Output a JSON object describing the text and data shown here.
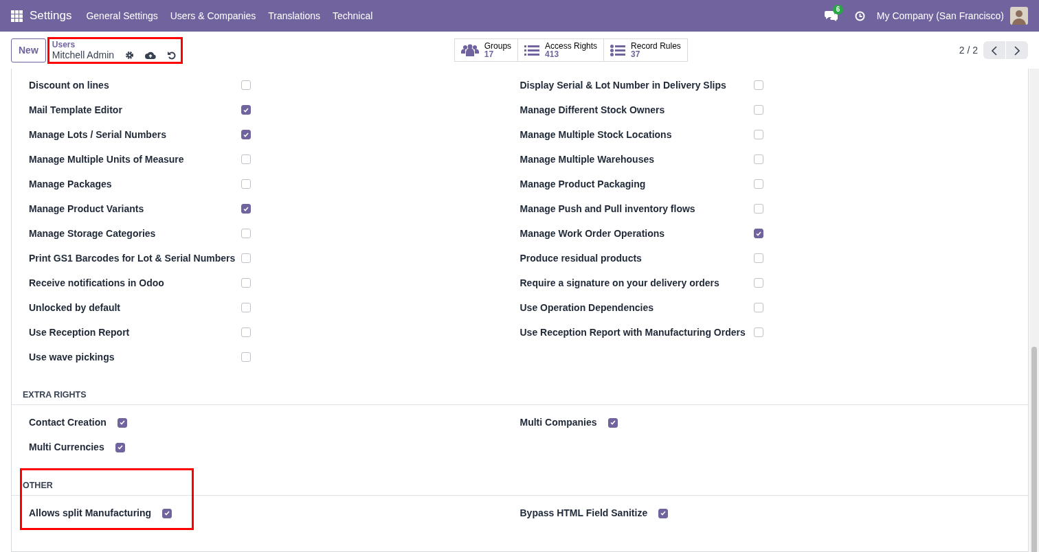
{
  "navbar": {
    "app": "Settings",
    "menus": [
      "General Settings",
      "Users & Companies",
      "Translations",
      "Technical"
    ],
    "messages_badge": "6",
    "company": "My Company (San Francisco)"
  },
  "control_panel": {
    "new_button": "New",
    "breadcrumb": {
      "parent": "Users",
      "current": "Mitchell Admin",
      "highlighted": true
    },
    "smart_buttons": [
      {
        "kind": "groups",
        "label": "Groups",
        "value": "17"
      },
      {
        "kind": "list",
        "label": "Access Rights",
        "value": "413"
      },
      {
        "kind": "bullets",
        "label": "Record Rules",
        "value": "37"
      }
    ],
    "pager": "2 / 2"
  },
  "sections": [
    {
      "kind": "table",
      "highlighted": false,
      "left": [
        {
          "label": "Discount on lines",
          "checked": false
        },
        {
          "label": "Mail Template Editor",
          "checked": true
        },
        {
          "label": "Manage Lots / Serial Numbers",
          "checked": true
        },
        {
          "label": "Manage Multiple Units of Measure",
          "checked": false
        },
        {
          "label": "Manage Packages",
          "checked": false
        },
        {
          "label": "Manage Product Variants",
          "checked": true
        },
        {
          "label": "Manage Storage Categories",
          "checked": false
        },
        {
          "label": "Print GS1 Barcodes for Lot & Serial Numbers",
          "checked": false
        },
        {
          "label": "Receive notifications in Odoo",
          "checked": false
        },
        {
          "label": "Unlocked by default",
          "checked": false
        },
        {
          "label": "Use Reception Report",
          "checked": false
        },
        {
          "label": "Use wave pickings",
          "checked": false
        }
      ],
      "right": [
        {
          "label": "Display Serial & Lot Number in Delivery Slips",
          "checked": false
        },
        {
          "label": "Manage Different Stock Owners",
          "checked": false
        },
        {
          "label": "Manage Multiple Stock Locations",
          "checked": false
        },
        {
          "label": "Manage Multiple Warehouses",
          "checked": false
        },
        {
          "label": "Manage Product Packaging",
          "checked": false
        },
        {
          "label": "Manage Push and Pull inventory flows",
          "checked": false
        },
        {
          "label": "Manage Work Order Operations",
          "checked": true
        },
        {
          "label": "Produce residual products",
          "checked": false
        },
        {
          "label": "Require a signature on your delivery orders",
          "checked": false
        },
        {
          "label": "Use Operation Dependencies",
          "checked": false
        },
        {
          "label": "Use Reception Report with Manufacturing Orders",
          "checked": false
        }
      ]
    },
    {
      "title": "EXTRA RIGHTS",
      "kind": "inline",
      "highlighted": false,
      "left": [
        {
          "label": "Contact Creation",
          "checked": true
        },
        {
          "label": "Multi Currencies",
          "checked": true
        }
      ],
      "right": [
        {
          "label": "Multi Companies",
          "checked": true
        }
      ]
    },
    {
      "title": "OTHER",
      "kind": "inline",
      "highlighted": true,
      "left": [
        {
          "label": "Allows split Manufacturing",
          "checked": true
        }
      ],
      "right": [
        {
          "label": "Bypass HTML Field Sanitize",
          "checked": true
        }
      ]
    }
  ]
}
